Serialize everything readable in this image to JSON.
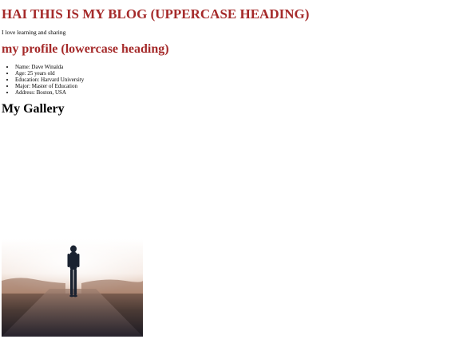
{
  "blog": {
    "uppercase_heading": "HAI THIS IS MY BLOG (UPPERCASE HEADING)",
    "intro": "I love learning and sharing",
    "lowercase_heading": "my profile (lowercase heading)",
    "profile_items": [
      "Name: Dave Winalda",
      "Age: 25 years old",
      "Education: Harvard University",
      "Major: Master of Education",
      "Address: Boston, USA"
    ],
    "gallery_heading": "My Gallery"
  },
  "colors": {
    "heading_accent": "#a52a2a",
    "text": "#000000",
    "background": "#ffffff"
  }
}
